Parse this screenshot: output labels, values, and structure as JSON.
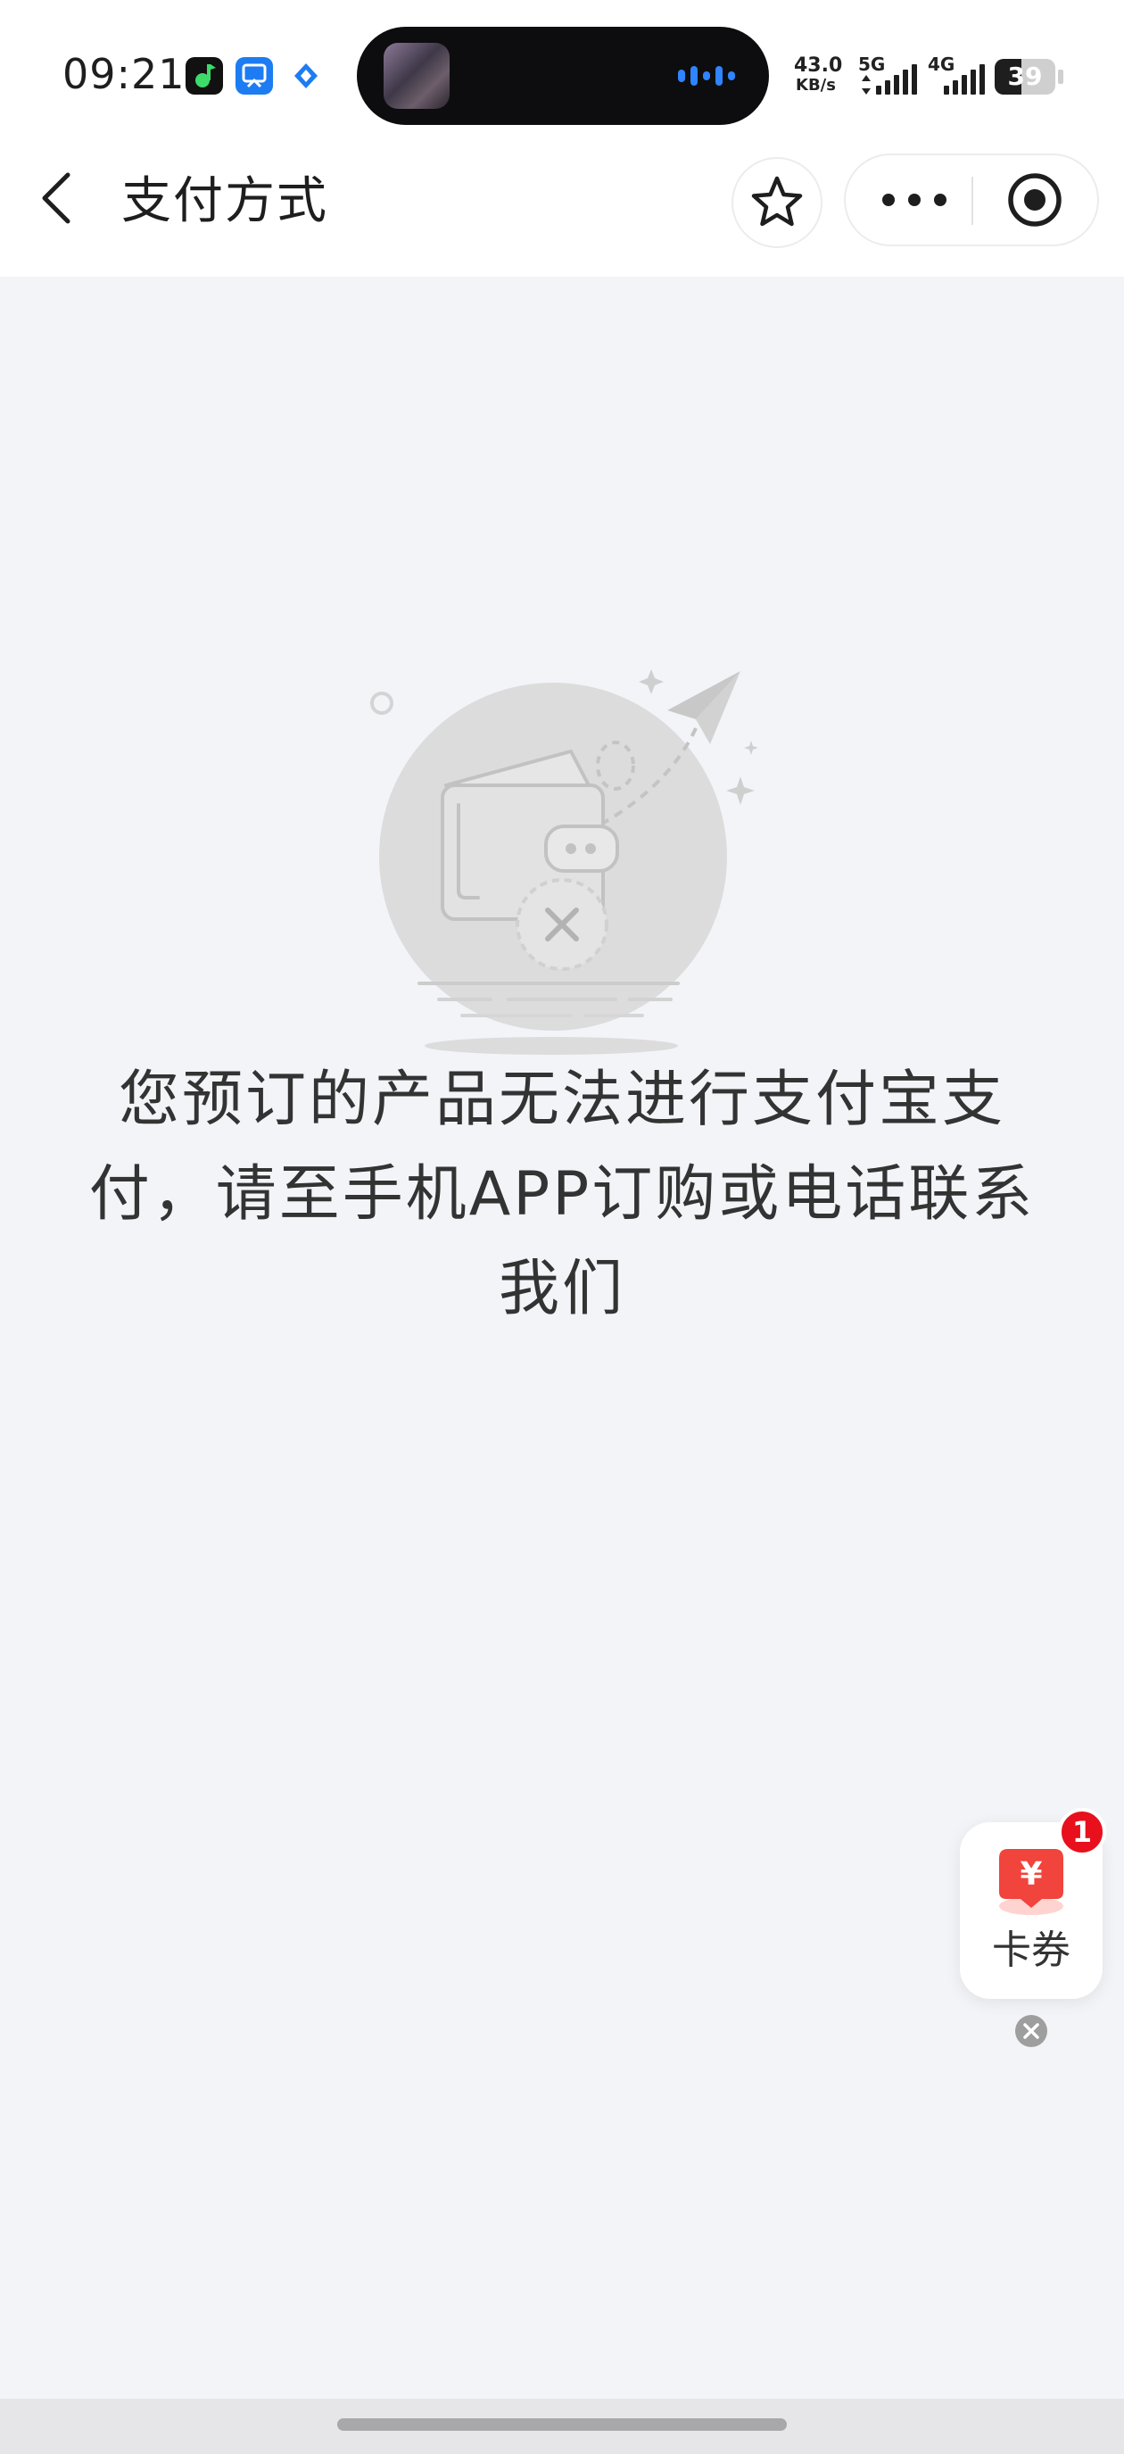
{
  "status_bar": {
    "time": "09:21",
    "network_speed_value": "43.0",
    "network_speed_unit": "KB/s",
    "sim1_network": "5G",
    "sim2_network": "4G",
    "battery_level": "39",
    "app_icons": [
      "green-music-app-icon",
      "blue-screen-capture-app-icon",
      "blue-diamond-app-icon"
    ]
  },
  "nav": {
    "title": "支付方式",
    "back_icon": "chevron-left-icon",
    "favorite_icon": "star-icon",
    "more_icon": "more-dots-icon",
    "close_icon": "target-circle-icon"
  },
  "main": {
    "illustration_icon": "wallet-payment-failed-icon",
    "message": "您预订的产品无法进行支付宝支付，请至手机APP订购或电话联系我们"
  },
  "coupon_float": {
    "label": "卡券",
    "badge_count": "1",
    "icon": "red-yen-coupon-icon",
    "close_icon": "close-circle-icon"
  },
  "colors": {
    "page_background": "#f3f4f8",
    "header_background": "#ffffff",
    "badge_red": "#e8101d",
    "coupon_red": "#f0443c",
    "illustration_gray": "#d9d9d9"
  }
}
